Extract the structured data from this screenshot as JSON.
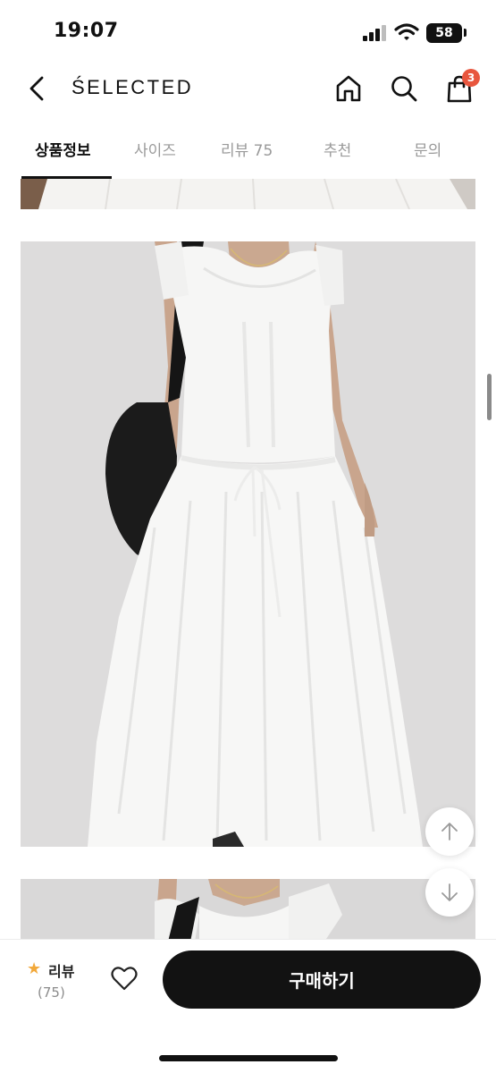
{
  "status_bar": {
    "time": "19:07",
    "battery": "58"
  },
  "header": {
    "brand": "ŚELECTED",
    "back_icon": "chevron-left-icon",
    "home_icon": "home-icon",
    "search_icon": "search-icon",
    "cart_icon": "shopping-bag-icon",
    "cart_count": "3"
  },
  "tabs": [
    {
      "label": "상품정보",
      "active": true
    },
    {
      "label": "사이즈",
      "active": false
    },
    {
      "label": "리뷰 75",
      "active": false
    },
    {
      "label": "추천",
      "active": false
    },
    {
      "label": "문의",
      "active": false
    }
  ],
  "images": [
    {
      "name": "product-image-top-strip"
    },
    {
      "name": "product-image-white-dress"
    },
    {
      "name": "product-image-next"
    }
  ],
  "floating": {
    "up_icon": "arrow-up-icon",
    "down_icon": "arrow-down-icon"
  },
  "bottom_bar": {
    "review_label": "리뷰",
    "review_count": "(75)",
    "star_icon": "star-icon",
    "wish_icon": "heart-icon",
    "buy_label": "구매하기"
  },
  "colors": {
    "accent": "#111111",
    "badge": "#e8563e",
    "star": "#f2a93b",
    "inactive_tab": "#9a9a9a"
  }
}
